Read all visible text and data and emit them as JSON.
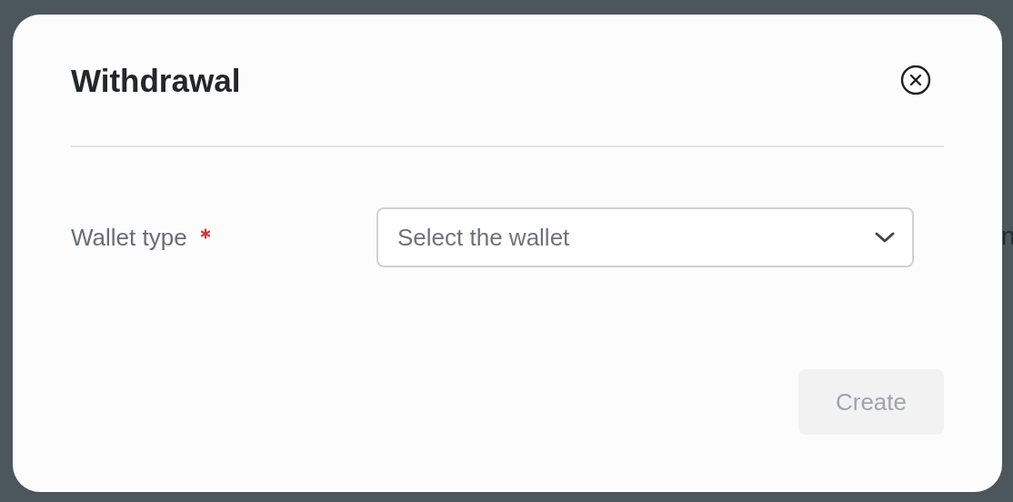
{
  "background": {
    "fragments": [
      {
        "text": "n"
      }
    ]
  },
  "dialog": {
    "title": "Withdrawal",
    "fields": [
      {
        "label": "Wallet type",
        "required": true,
        "kind": "select",
        "placeholder": "Select the wallet"
      }
    ],
    "button": {
      "label": "Create",
      "disabled": true
    }
  }
}
